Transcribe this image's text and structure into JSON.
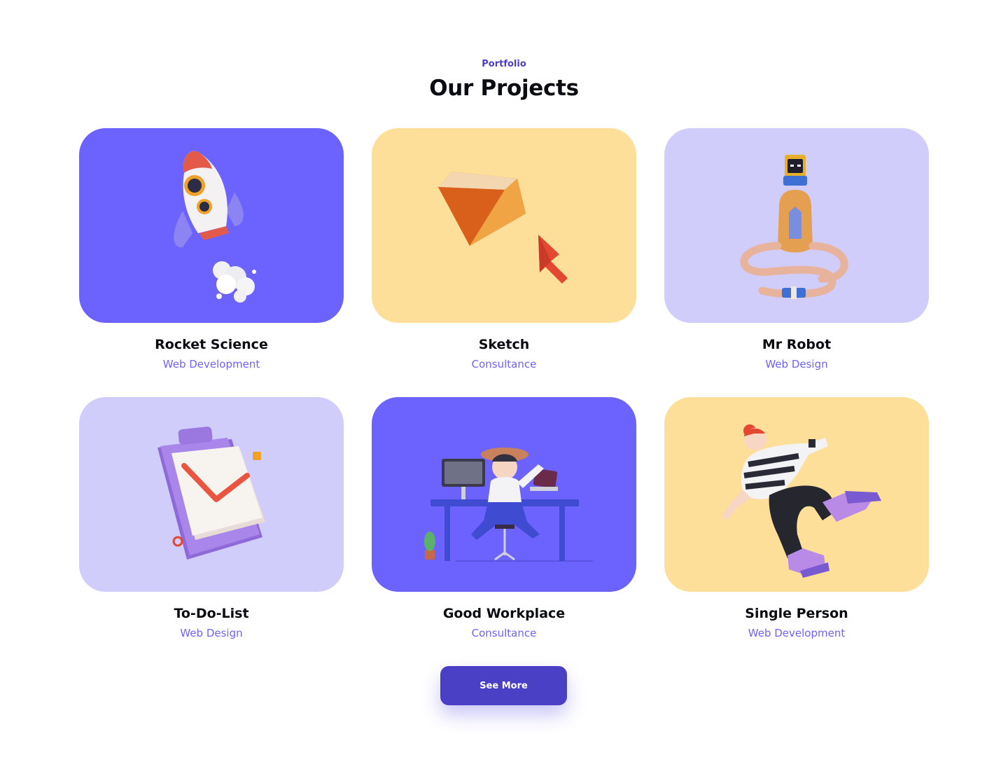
{
  "section": {
    "eyebrow": "Portfolio",
    "title": "Our Projects"
  },
  "projects": [
    {
      "name": "Rocket Science",
      "category": "Web Development",
      "illustration": "rocket-icon",
      "bg": "#6c63fe"
    },
    {
      "name": "Sketch",
      "category": "Consultance",
      "illustration": "diamond-icon",
      "bg": "#fedf9a"
    },
    {
      "name": "Mr Robot",
      "category": "Web Design",
      "illustration": "robot-icon",
      "bg": "#d0cdfb"
    },
    {
      "name": "To-Do-List",
      "category": "Web Design",
      "illustration": "clipboard-icon",
      "bg": "#d0cdfb"
    },
    {
      "name": "Good Workplace",
      "category": "Consultance",
      "illustration": "workplace-icon",
      "bg": "#6c63fe"
    },
    {
      "name": "Single Person",
      "category": "Web Development",
      "illustration": "person-icon",
      "bg": "#fedf9a"
    }
  ],
  "cta": {
    "label": "See More"
  },
  "colors": {
    "accent": "#4a40c6",
    "category_text": "#6c63ff",
    "violet": "#6c63fe",
    "yellow": "#fedf9a",
    "lilac": "#d0cdfb"
  }
}
